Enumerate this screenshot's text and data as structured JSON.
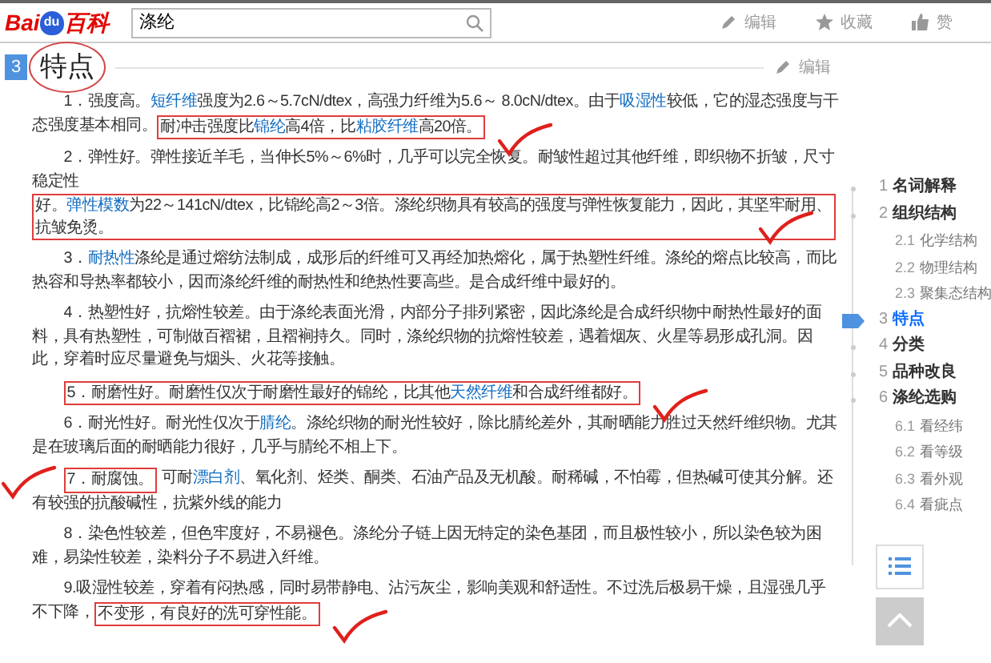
{
  "header": {
    "logo": {
      "left": "Bai",
      "paw": "du",
      "right": "百科"
    },
    "search": {
      "value": "涤纶"
    },
    "actions": [
      {
        "kind": "edit",
        "label": "编辑"
      },
      {
        "kind": "star",
        "label": "收藏"
      },
      {
        "kind": "like",
        "label": "赞"
      }
    ]
  },
  "section": {
    "number": "3",
    "title": "特点",
    "circled": true,
    "edit": "编辑"
  },
  "paragraphs": [
    {
      "segments": [
        {
          "kind": "text",
          "text": "1．强度高。"
        },
        {
          "kind": "link",
          "text": "短纤维"
        },
        {
          "kind": "text",
          "text": "强度为2.6～5.7cN/dtex，高强力纤维为5.6～ 8.0cN/dtex。由于"
        },
        {
          "kind": "link",
          "text": "吸湿性"
        },
        {
          "kind": "text",
          "text": "较低，它的湿态强度与干态强度基本相同。"
        },
        {
          "kind": "highlight",
          "parts": [
            {
              "kind": "text",
              "text": "耐冲击强度比"
            },
            {
              "kind": "link",
              "text": "锦纶"
            },
            {
              "kind": "text",
              "text": "高4倍，比"
            },
            {
              "kind": "link",
              "text": "粘胶纤维"
            },
            {
              "kind": "text",
              "text": "高20倍。"
            }
          ]
        },
        {
          "kind": "check"
        }
      ]
    },
    {
      "segments": [
        {
          "kind": "text",
          "text": "2．弹性好。弹性接近羊毛，当伸长5%～6%时，几乎可以完全恢复。耐皱性超过其他纤维，即织物不折皱，尺寸稳定性"
        },
        {
          "kind": "highlight",
          "parts": [
            {
              "kind": "text",
              "text": "好。"
            },
            {
              "kind": "link",
              "text": "弹性模数"
            },
            {
              "kind": "text",
              "text": "为22～141cN/dtex，比锦纶高2～3倍。涤纶织物具有较高的强度与弹性恢复能力，因此，其坚牢耐用、抗皱免烫。"
            }
          ]
        },
        {
          "kind": "check"
        }
      ]
    },
    {
      "segments": [
        {
          "kind": "text",
          "text": "3．"
        },
        {
          "kind": "link",
          "text": "耐热性"
        },
        {
          "kind": "text",
          "text": "涤纶是通过熔纺法制成，成形后的纤维可又再经加热熔化，属于热塑性纤维。涤纶的熔点比较高，而比热容和导热率都较小，因而涤纶纤维的耐热性和绝热性要高些。是合成纤维中最好的。"
        }
      ]
    },
    {
      "segments": [
        {
          "kind": "text",
          "text": "4．热塑性好，抗熔性较差。由于涤纶表面光滑，内部分子排列紧密，因此涤纶是合成纤织物中耐热性最好的面料，具有热塑性，可制做百褶裙，且褶裥持久。同时，涤纶织物的抗熔性较差，遇着烟灰、火星等易形成孔洞。因此，穿着时应尽量避免与烟头、火花等接触。"
        }
      ]
    },
    {
      "segments": [
        {
          "kind": "highlight",
          "parts": [
            {
              "kind": "text",
              "text": "5．耐磨性好。耐磨性仅次于耐磨性最好的锦纶，比其他"
            },
            {
              "kind": "link",
              "text": "天然纤维"
            },
            {
              "kind": "text",
              "text": "和合成纤维都好。"
            }
          ]
        },
        {
          "kind": "check"
        }
      ]
    },
    {
      "segments": [
        {
          "kind": "text",
          "text": "6．耐光性好。耐光性仅次于"
        },
        {
          "kind": "link",
          "text": "腈纶"
        },
        {
          "kind": "text",
          "text": "。涤纶织物的耐光性较好，除比腈纶差外，其耐晒能力胜过天然纤维织物。尤其是在玻璃后面的耐晒能力很好，几乎与腈纶不相上下。"
        }
      ]
    },
    {
      "segments": [
        {
          "kind": "check"
        },
        {
          "kind": "highlight",
          "parts": [
            {
              "kind": "text",
              "text": "7．耐腐蚀。"
            }
          ]
        },
        {
          "kind": "text",
          "text": "可耐"
        },
        {
          "kind": "link",
          "text": "漂白剂"
        },
        {
          "kind": "text",
          "text": "、氧化剂、烃类、酮类、石油产品及无机酸。耐稀碱，不怕霉，但热碱可使其分解。还有较强的抗酸碱性，抗紫外线的能力"
        }
      ]
    },
    {
      "segments": [
        {
          "kind": "text",
          "text": "8．染色性较差，但色牢度好，不易褪色。涤纶分子链上因无特定的染色基团，而且极性较小，所以染色较为困难，易染性较差，染料分子不易进入纤维。"
        }
      ]
    },
    {
      "segments": [
        {
          "kind": "text",
          "text": "9.吸湿性较差，穿着有闷热感，同时易带静电、沾污灰尘，影响美观和舒适性。不过洗后极易干燥，且湿强几乎不下降，"
        },
        {
          "kind": "highlight",
          "parts": [
            {
              "kind": "text",
              "text": "不变形，有良好的洗可穿性能。"
            }
          ]
        },
        {
          "kind": "check"
        }
      ]
    }
  ],
  "toc": [
    {
      "num": "1",
      "label": "名词解释",
      "selected": false
    },
    {
      "num": "2",
      "label": "组织结构",
      "selected": false,
      "children": [
        {
          "num": "2.1",
          "label": "化学结构",
          "selected": false
        },
        {
          "num": "2.2",
          "label": "物理结构",
          "selected": false
        },
        {
          "num": "2.3",
          "label": "聚集态结构",
          "selected": false
        }
      ]
    },
    {
      "num": "3",
      "label": "特点",
      "selected": true
    },
    {
      "num": "4",
      "label": "分类",
      "selected": false
    },
    {
      "num": "5",
      "label": "品种改良",
      "selected": false
    },
    {
      "num": "6",
      "label": "涤纶选购",
      "selected": false,
      "children": [
        {
          "num": "6.1",
          "label": "看经纬",
          "selected": false
        },
        {
          "num": "6.2",
          "label": "看等级",
          "selected": false
        },
        {
          "num": "6.3",
          "label": "看外观",
          "selected": false
        },
        {
          "num": "6.4",
          "label": "看疵点",
          "selected": false
        }
      ]
    }
  ]
}
